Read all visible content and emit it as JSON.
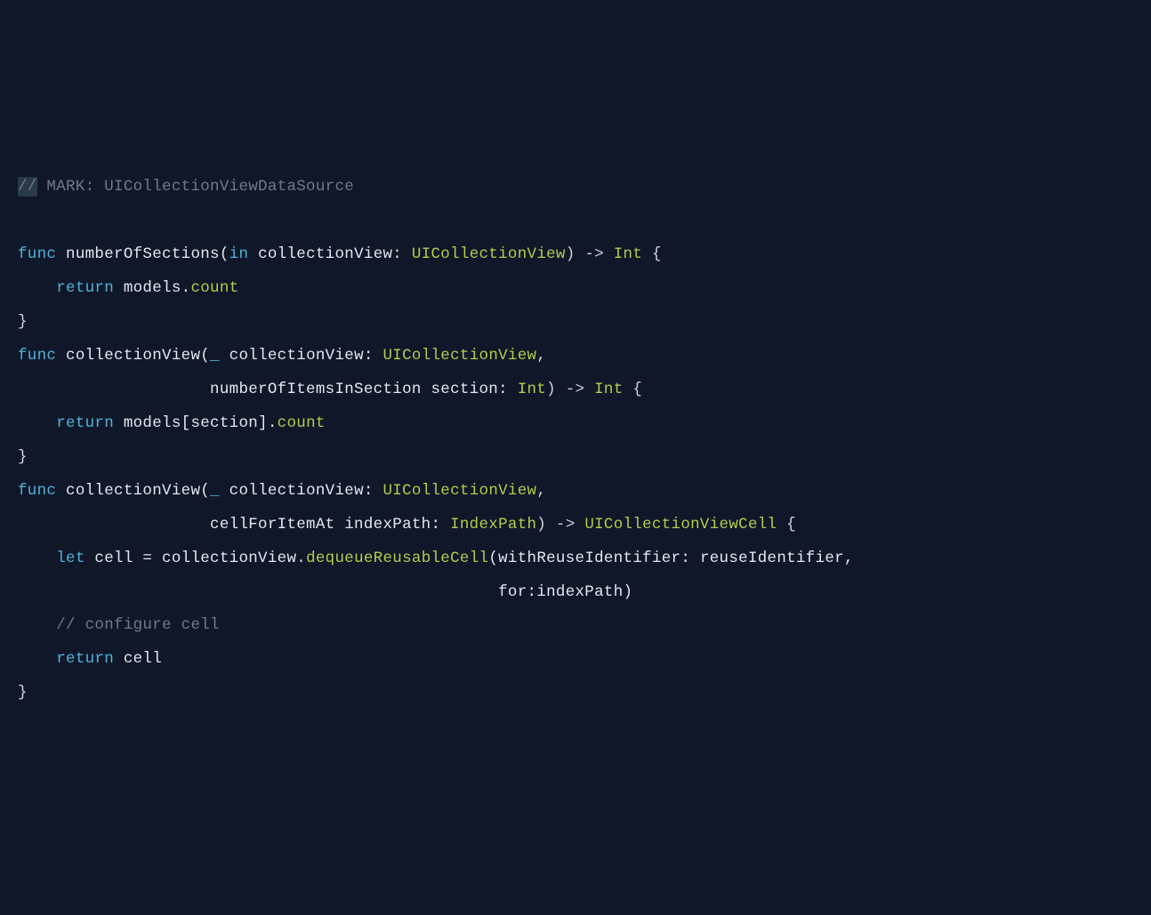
{
  "code": {
    "line1": {
      "comment_prefix": "//",
      "comment_text": " MARK: UICollectionViewDataSource"
    },
    "line2": "",
    "line3": {
      "t1": "func",
      "t2": " numberOfSections(",
      "t3": "in",
      "t4": " collectionView: ",
      "t5": "UICollectionView",
      "t6": ") -> ",
      "t7": "Int",
      "t8": " {"
    },
    "line4": {
      "t1": "    ",
      "t2": "return",
      "t3": " models.",
      "t4": "count"
    },
    "line5": "}",
    "line6": {
      "t1": "func",
      "t2": " collectionView(",
      "t3": "_",
      "t4": " collectionView: ",
      "t5": "UICollectionView",
      "t6": ","
    },
    "line7": {
      "t1": "                    numberOfItemsInSection section: ",
      "t2": "Int",
      "t3": ") -> ",
      "t4": "Int",
      "t5": " {"
    },
    "line8": {
      "t1": "    ",
      "t2": "return",
      "t3": " models[section].",
      "t4": "count"
    },
    "line9": "}",
    "line10": {
      "t1": "func",
      "t2": " collectionView(",
      "t3": "_",
      "t4": " collectionView: ",
      "t5": "UICollectionView",
      "t6": ","
    },
    "line11": {
      "t1": "                    cellForItemAt indexPath: ",
      "t2": "IndexPath",
      "t3": ") -> ",
      "t4": "UICollectionViewCell",
      "t5": " {"
    },
    "line12": {
      "t1": "    ",
      "t2": "let",
      "t3": " cell = collectionView.",
      "t4": "dequeueReusableCell",
      "t5": "(withReuseIdentifier: reuseIdentifier,"
    },
    "line13": {
      "t1": "                                                  for:indexPath)"
    },
    "line14": {
      "t1": "    ",
      "t2": "// configure cell"
    },
    "line15": {
      "t1": "    ",
      "t2": "return",
      "t3": " cell"
    },
    "line16": "}"
  }
}
